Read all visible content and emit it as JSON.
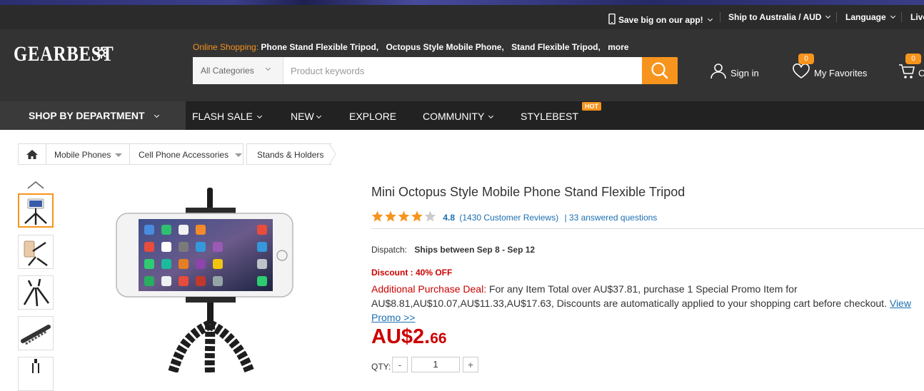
{
  "topbar": {
    "app": "Save big on our app!",
    "ship": "Ship to Australia / AUD",
    "language": "Language",
    "live": "Live"
  },
  "header": {
    "logo": "GEARBEST",
    "hot_label": "Online Shopping:",
    "hot_keywords": [
      "Phone Stand Flexible Tripod,",
      "Octopus Style Mobile Phone,",
      "Stand Flexible Tripod,",
      "more"
    ],
    "search": {
      "category": "All Categories",
      "placeholder": "Product keywords"
    },
    "signin": "Sign in",
    "favorites": {
      "label": "My Favorites",
      "count": "0"
    },
    "cart": {
      "label": "C",
      "count": "0"
    }
  },
  "nav": {
    "shop_by_department": "SHOP BY DEPARTMENT",
    "items": [
      "FLASH SALE",
      "NEW",
      "EXPLORE",
      "COMMUNITY",
      "STYLEBEST"
    ],
    "hot_tag": "HOT"
  },
  "breadcrumb": [
    "Mobile Phones",
    "Cell Phone Accessories",
    "Stands & Holders"
  ],
  "product": {
    "title": "Mini Octopus Style Mobile Phone Stand Flexible Tripod",
    "rating": "4.8",
    "rating_fraction": 0.96,
    "reviews": "(1430 Customer Reviews)",
    "questions": "| 33 answered questions",
    "dispatch_label": "Dispatch:",
    "dispatch_value": "Ships between Sep 8 - Sep 12",
    "discount": "Discount : 40% OFF",
    "deal_label": "Additional Purchase Deal:",
    "deal_text": "For any Item Total over AU$37.81, purchase 1 Special Promo Item for AU$8.81,AU$10.07,AU$11.33,AU$17.63, Discounts are automatically applied to your shopping cart before checkout.",
    "deal_link": "View Promo >>",
    "price_main": "AU$2.",
    "price_cents": "66",
    "qty_label": "QTY:",
    "qty_value": "1",
    "qty_minus": "-",
    "qty_plus": "+"
  },
  "colors": {
    "accent": "#f7941d",
    "price": "#cc0000",
    "link": "#1c6fb0",
    "header_bg": "#333333"
  }
}
